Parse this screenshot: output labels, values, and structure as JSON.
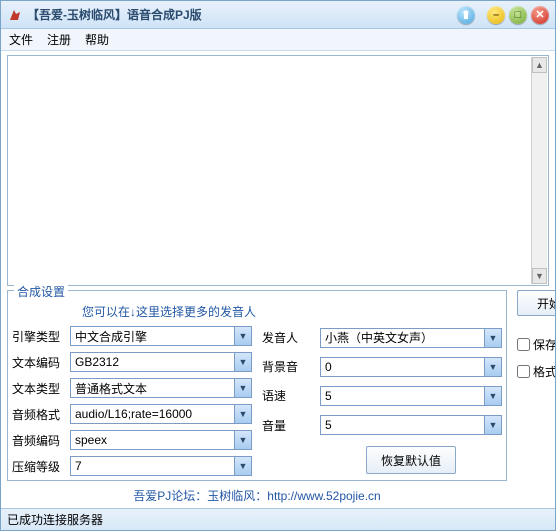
{
  "window": {
    "title": "【吾爱-玉树临风】语音合成PJ版"
  },
  "menu": {
    "file": "文件",
    "register": "注册",
    "help": "帮助"
  },
  "group": {
    "title": "合成设置",
    "tip_prefix": "您可以在",
    "tip_arrow": "↓",
    "tip_suffix": "这里选择更多的发音人"
  },
  "labels": {
    "engine": "引擎类型",
    "encoding": "文本编码",
    "textType": "文本类型",
    "audioFmt": "音频格式",
    "audioEnc": "音频编码",
    "compress": "压缩等级",
    "speaker": "发音人",
    "bgm": "背景音",
    "speed": "语速",
    "volume": "音量"
  },
  "values": {
    "engine": "中文合成引擎",
    "encoding": "GB2312",
    "textType": "普通格式文本",
    "audioFmt": "audio/L16;rate=16000",
    "audioEnc": "speex",
    "compress": "7",
    "speaker": "小燕（中英文女声）",
    "bgm": "0",
    "speed": "5",
    "volume": "5"
  },
  "buttons": {
    "start": "开始合成",
    "restore": "恢复默认值"
  },
  "checks": {
    "save": "保存语音文件",
    "convert": "格式转换工具"
  },
  "footer": "吾爱PJ论坛：玉树临风：http://www.52pojie.cn",
  "status": "已成功连接服务器"
}
